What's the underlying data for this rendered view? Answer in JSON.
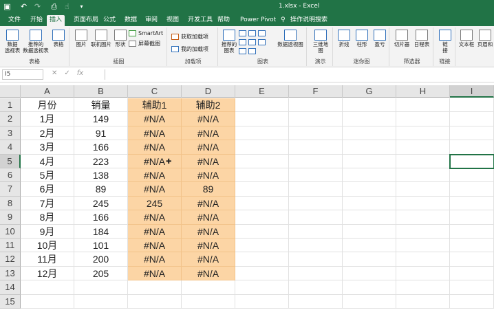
{
  "titlebar": {
    "file_title": "1.xlsx  -  Excel"
  },
  "quickaccess": [
    "save",
    "undo",
    "redo",
    "print-preview",
    "customize"
  ],
  "tabs": [
    "文件",
    "开始",
    "插入",
    "页面布局",
    "公式",
    "数据",
    "审阅",
    "视图",
    "开发工具",
    "帮助",
    "Power Pivot"
  ],
  "tab_active": "插入",
  "tell_me": "操作说明搜索",
  "ribbon": {
    "tables": {
      "label": "表格",
      "pivot": "数据\n透视表",
      "rec_pivot": "推荐的\n数据透视表",
      "table": "表格"
    },
    "illus": {
      "label": "插图",
      "picture": "图片",
      "online_pic": "联机图片",
      "shapes": "形状",
      "smartart": "SmartArt",
      "screenshot": "屏幕截图"
    },
    "addins": {
      "label": "加载项",
      "get": "获取加载项",
      "my": "我的加载项"
    },
    "charts": {
      "label": "图表",
      "recommended": "推荐的\n图表",
      "pivotchart": "数据透视图"
    },
    "tours": {
      "label": "演示",
      "map3d": "三维地\n图"
    },
    "spark": {
      "label": "迷你图",
      "line": "折线",
      "column": "柱形",
      "winloss": "盈亏"
    },
    "filters": {
      "label": "筛选器",
      "slicer": "切片器",
      "timeline": "日程表"
    },
    "links": {
      "label": "链接",
      "link": "链\n接"
    },
    "text": {
      "textbox": "文本框",
      "headerfooter": "页眉和"
    }
  },
  "namebox": "I5",
  "columns": [
    "A",
    "B",
    "C",
    "D",
    "E",
    "F",
    "G",
    "H",
    "I"
  ],
  "rows": [
    "1",
    "2",
    "3",
    "4",
    "5",
    "6",
    "7",
    "8",
    "9",
    "10",
    "11",
    "12",
    "13",
    "14",
    "15"
  ],
  "headers": [
    "月份",
    "销量",
    "辅助1",
    "辅助2"
  ],
  "table": [
    [
      "1月",
      "149",
      "#N/A",
      "#N/A"
    ],
    [
      "2月",
      "91",
      "#N/A",
      "#N/A"
    ],
    [
      "3月",
      "166",
      "#N/A",
      "#N/A"
    ],
    [
      "4月",
      "223",
      "#N/A",
      "#N/A"
    ],
    [
      "5月",
      "138",
      "#N/A",
      "#N/A"
    ],
    [
      "6月",
      "89",
      "#N/A",
      "89"
    ],
    [
      "7月",
      "245",
      "245",
      "#N/A"
    ],
    [
      "8月",
      "166",
      "#N/A",
      "#N/A"
    ],
    [
      "9月",
      "184",
      "#N/A",
      "#N/A"
    ],
    [
      "10月",
      "101",
      "#N/A",
      "#N/A"
    ],
    [
      "11月",
      "200",
      "#N/A",
      "#N/A"
    ],
    [
      "12月",
      "205",
      "#N/A",
      "#N/A"
    ]
  ],
  "colors": {
    "excel_green": "#217346",
    "helper_fill": "#fcd5a5"
  }
}
